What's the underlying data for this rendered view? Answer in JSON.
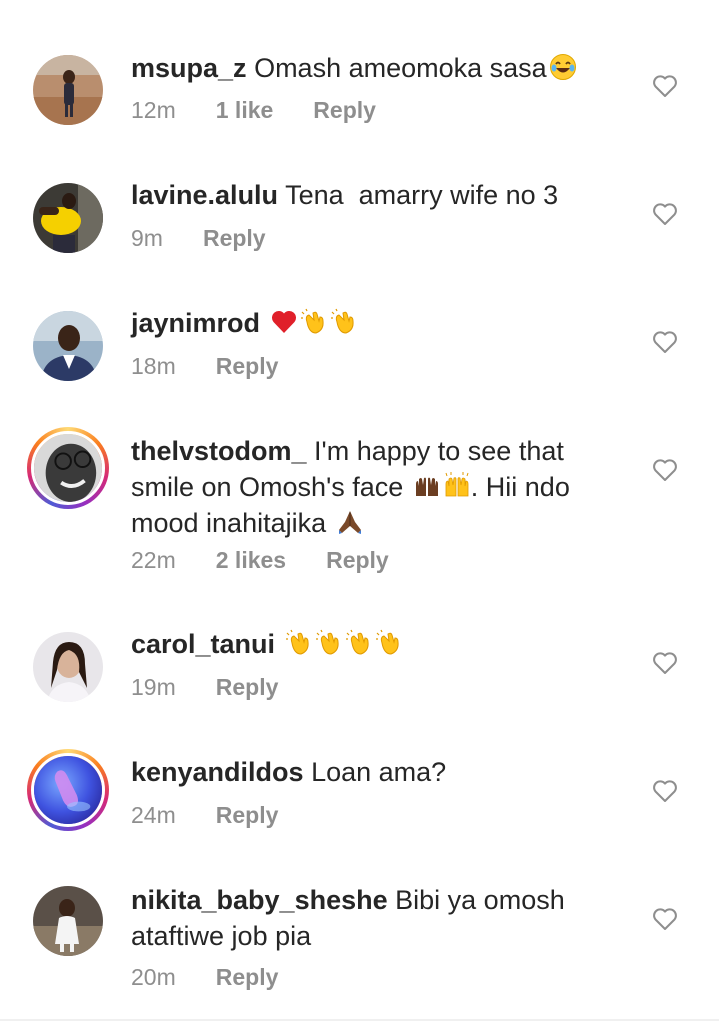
{
  "comments": [
    {
      "username": "msupa_z",
      "text": "Omash ameomoka sasa",
      "emoji": [
        "laughing-tears-emoji"
      ],
      "time": "12m",
      "likes": "1 like",
      "reply": "Reply"
    },
    {
      "username": "lavine.alulu",
      "text": "Tena  amarry wife no 3",
      "time": "9m",
      "reply": "Reply"
    },
    {
      "username": "jaynimrod",
      "text": "",
      "emoji": [
        "red-heart-emoji",
        "clapping-hands-emoji",
        "clapping-hands-emoji"
      ],
      "time": "18m",
      "reply": "Reply"
    },
    {
      "username": "thelvstodom_",
      "text_line1": "I'm happy to see that",
      "text_line2a": "smile on Omosh's face",
      "text_line2b": ". Hii ndo",
      "text_line3": "mood inahitajika",
      "emoji": [
        "raising-hands-dark-emoji",
        "raising-hands-emoji",
        "folded-hands-emoji"
      ],
      "time": "22m",
      "likes": "2 likes",
      "reply": "Reply"
    },
    {
      "username": "carol_tanui",
      "text": "",
      "emoji": [
        "clapping-hands-emoji",
        "clapping-hands-emoji",
        "clapping-hands-emoji",
        "clapping-hands-emoji"
      ],
      "time": "19m",
      "reply": "Reply"
    },
    {
      "username": "kenyandildos",
      "text": "Loan ama?",
      "time": "24m",
      "reply": "Reply"
    },
    {
      "username": "nikita_baby_sheshe",
      "text_line1": "Bibi ya omosh",
      "text_line2": "ataftiwe job pia",
      "time": "20m",
      "reply": "Reply"
    }
  ],
  "icons": {
    "like": "heart-outline-icon"
  },
  "colors": {
    "text": "#262626",
    "meta": "#8e8e8e",
    "heart_outline": "#8e8e8e"
  }
}
